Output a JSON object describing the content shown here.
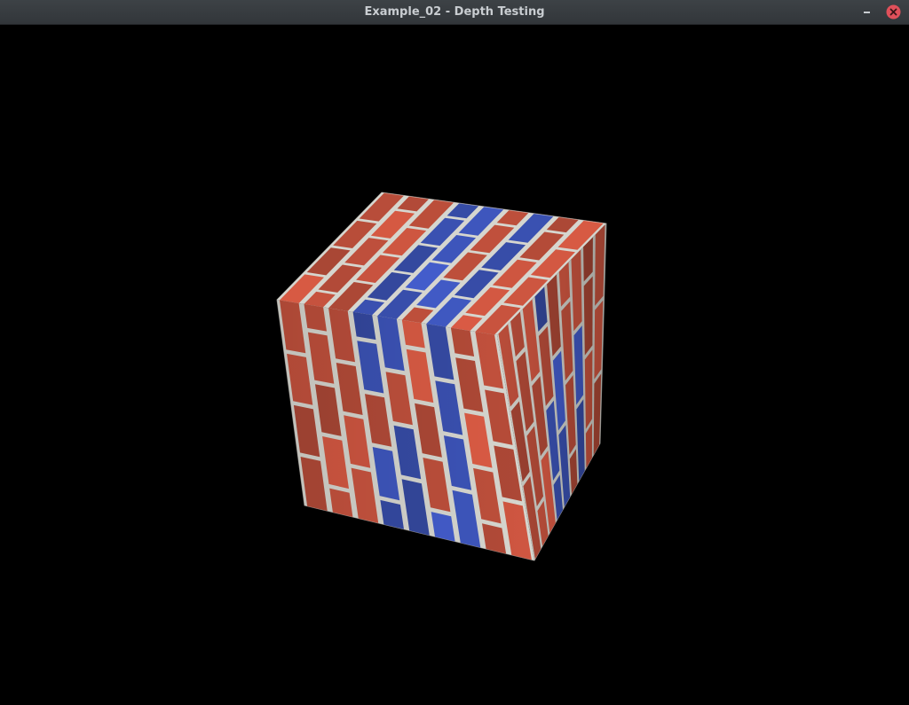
{
  "window": {
    "title": "Example_02 - Depth Testing",
    "buttons": {
      "minimize_icon": "minimize-icon",
      "close_icon": "close-icon"
    },
    "colors": {
      "titlebar": "#373b3f",
      "title_text": "#c9cdd1",
      "close_button": "#e0505a",
      "background": "#000000"
    }
  },
  "scene": {
    "object": "cube",
    "texture": "brick",
    "brick_colors": {
      "red": "#c0503c",
      "blue": "#3b52b4",
      "mortar": "#d6d6cf"
    }
  }
}
